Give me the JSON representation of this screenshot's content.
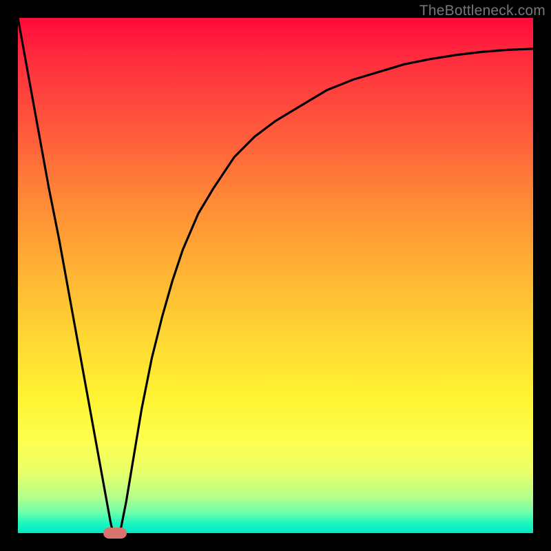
{
  "watermark": "TheBottleneck.com",
  "colors": {
    "frame": "#000000",
    "curve": "#000000",
    "marker": "#d9736e",
    "gradient_top": "#ff0a3a",
    "gradient_bottom": "#00e8c5"
  },
  "chart_data": {
    "type": "line",
    "title": "",
    "xlabel": "",
    "ylabel": "",
    "xlim": [
      0,
      100
    ],
    "ylim": [
      0,
      100
    ],
    "grid": false,
    "series": [
      {
        "name": "bottleneck-curve",
        "x": [
          0,
          2,
          4,
          6,
          8,
          10,
          12,
          14,
          16,
          18,
          18.5,
          19,
          19.5,
          20,
          21,
          22,
          24,
          26,
          28,
          30,
          32,
          35,
          38,
          42,
          46,
          50,
          55,
          60,
          65,
          70,
          75,
          80,
          85,
          90,
          95,
          100
        ],
        "values": [
          100,
          89,
          78,
          67,
          57,
          46,
          35,
          24,
          13,
          2,
          0,
          0,
          0,
          1,
          6,
          12,
          24,
          34,
          42,
          49,
          55,
          62,
          67,
          73,
          77,
          80,
          83,
          86,
          88,
          89.5,
          91,
          92,
          92.8,
          93.4,
          93.8,
          94
        ]
      }
    ],
    "annotations": [
      {
        "name": "optimal-marker",
        "x": 18.8,
        "y": 0
      }
    ]
  }
}
